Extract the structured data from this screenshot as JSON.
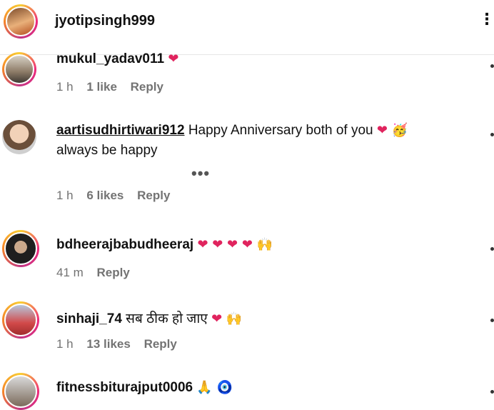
{
  "header": {
    "username": "jyotipsingh999",
    "more_icon": "⋮"
  },
  "comments": [
    {
      "username": "mukul_yadav011",
      "text": "",
      "emojis": "❤",
      "time": "1 h",
      "likes": "1 like",
      "reply": "Reply"
    },
    {
      "username": "aartisudhirtiwari912",
      "text": "Happy Anniversary both of you",
      "emojis": "❤ 🥳",
      "text2": "always be happy",
      "more": "•••",
      "time": "1 h",
      "likes": "6 likes",
      "reply": "Reply"
    },
    {
      "username": "bdheerajbabudheeraj",
      "text": "",
      "emojis": "❤ ❤ ❤ ❤ 🙌",
      "time": "41 m",
      "likes": "",
      "reply": "Reply"
    },
    {
      "username": "sinhaji_74",
      "text": "सब ठीक हो जाए",
      "emojis": "❤ 🙌",
      "time": "1 h",
      "likes": "13 likes",
      "reply": "Reply"
    },
    {
      "username": "fitnessbiturajput0006",
      "text": "",
      "emojis": "🙏 🧿",
      "time": "",
      "likes": "",
      "reply": ""
    }
  ],
  "colors": {
    "heart": "#e0245e",
    "meta": "#737373",
    "ring": "#ee2a7b"
  },
  "icons": [
    "heart-icon",
    "party-face-icon",
    "raised-hands-icon",
    "folded-hands-icon",
    "nazar-amulet-icon",
    "more-dots-icon"
  ]
}
